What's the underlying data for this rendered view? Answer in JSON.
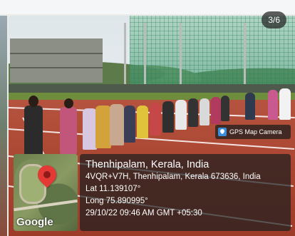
{
  "viewer": {
    "page_indicator": "3/6"
  },
  "gps_overlay": {
    "brand": "GPS Map Camera",
    "location_title": "Thenhipalam, Kerala, India",
    "address": "4VQR+V7H, Thenhipalam, Kerala 673636, India",
    "lat": "Lat 11.139107°",
    "long": "Long 75.890995°",
    "datetime": "29/10/22 09:46 AM GMT +05:30",
    "map_label": "Google"
  },
  "colors": {
    "track": "#a8432f",
    "overlay": "#1e1e1e",
    "pin": "#e53935"
  }
}
